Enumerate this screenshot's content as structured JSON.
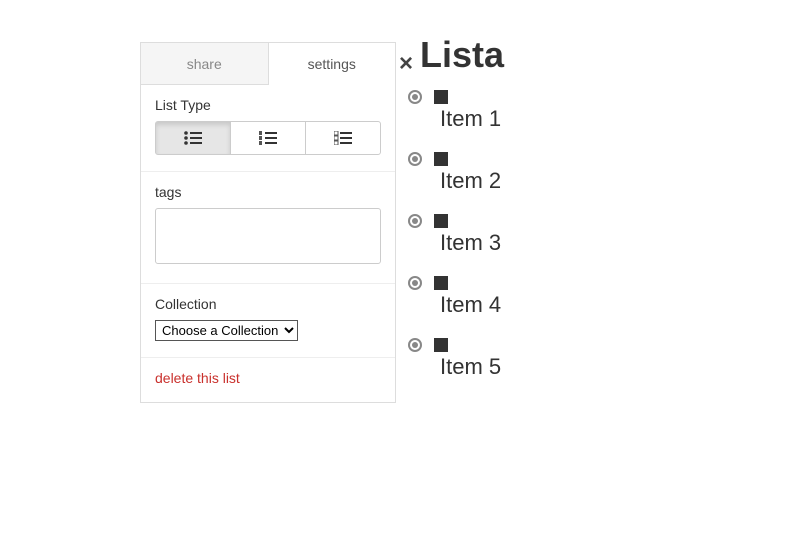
{
  "tabs": {
    "share": "share",
    "settings": "settings"
  },
  "close_glyph": "×",
  "listType": {
    "label": "List Type"
  },
  "tags": {
    "label": "tags",
    "value": ""
  },
  "collection": {
    "label": "Collection",
    "selected": "Choose a Collection"
  },
  "delete": {
    "label": "delete this list"
  },
  "list": {
    "title": "Lista",
    "items": [
      "Item 1",
      "Item 2",
      "Item 3",
      "Item 4",
      "Item 5"
    ]
  }
}
